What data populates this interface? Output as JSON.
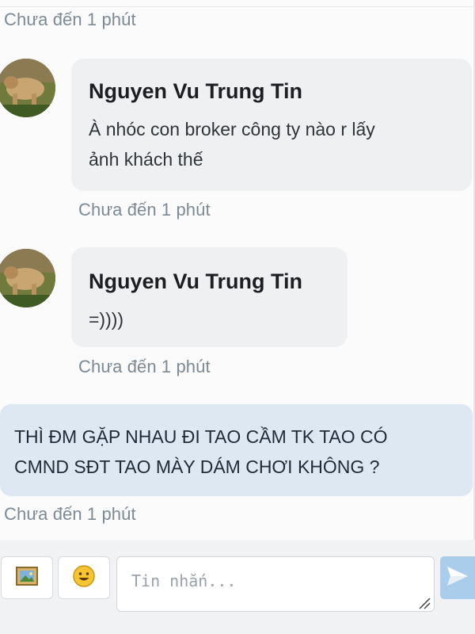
{
  "messages": [
    {
      "sender": "Nguyen Vu Trung Tin",
      "lines": [
        "À nhóc con broker công ty nào r lấy",
        "ảnh khách thế"
      ],
      "time": "Chưa đến 1 phút"
    },
    {
      "sender": "Nguyen Vu Trung Tin",
      "lines": [
        "=))))"
      ],
      "time": "Chưa đến 1 phút"
    }
  ],
  "top_time": "Chưa đến 1 phút",
  "outgoing": {
    "lines": [
      "THÌ ĐM GẶP NHAU ĐI TAO CẦM TK TAO CÓ",
      "CMND SĐT TAO MÀY DÁM CHƠI KHÔNG ?"
    ],
    "time": "Chưa đến 1 phút"
  },
  "composer": {
    "placeholder": "Tin nhắn...",
    "image_icon": "image-icon",
    "emoji_icon": "emoji-icon",
    "send_icon": "send-icon"
  },
  "colors": {
    "incoming_bubble": "#eef0f2",
    "outgoing_bubble": "#dde8f2",
    "send_button": "#a9cdea",
    "timestamp": "#7c8a95"
  }
}
